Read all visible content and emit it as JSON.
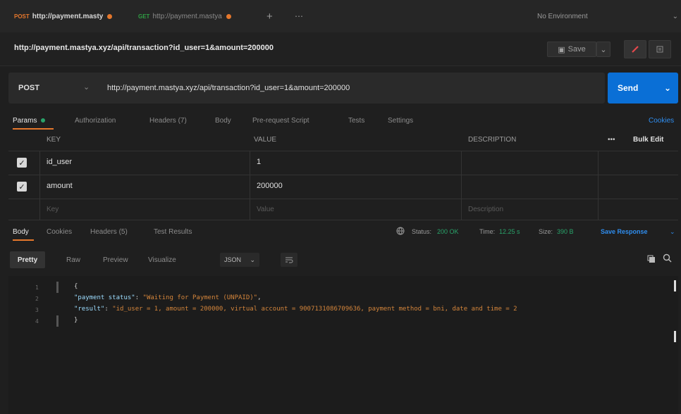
{
  "tabs": [
    {
      "method": "POST",
      "label": "http://payment.masty"
    },
    {
      "method": "GET",
      "label": "http://payment.mastya"
    }
  ],
  "tab_actions": {
    "add": "+",
    "more": "⋯"
  },
  "environment": {
    "label": "No Environment"
  },
  "title": "http://payment.mastya.xyz/api/transaction?id_user=1&amount=200000",
  "save": {
    "label": "Save"
  },
  "request": {
    "method": "POST",
    "url": "http://payment.mastya.xyz/api/transaction?id_user=1&amount=200000",
    "send_label": "Send"
  },
  "request_tabs": {
    "params": "Params",
    "authorization": "Authorization",
    "headers": "Headers (7)",
    "body": "Body",
    "pre_request": "Pre-request Script",
    "tests": "Tests",
    "settings": "Settings",
    "cookies": "Cookies"
  },
  "params_table": {
    "headers": {
      "key": "KEY",
      "value": "VALUE",
      "description": "DESCRIPTION",
      "more": "•••",
      "bulk_edit": "Bulk Edit"
    },
    "rows": [
      {
        "key": "id_user",
        "value": "1",
        "checked": true
      },
      {
        "key": "amount",
        "value": "200000",
        "checked": true
      }
    ],
    "placeholder": {
      "key": "Key",
      "value": "Value",
      "description": "Description"
    }
  },
  "response_tabs": {
    "body": "Body",
    "cookies": "Cookies",
    "headers": "Headers (5)",
    "test_results": "Test Results"
  },
  "status": {
    "status_label": "Status:",
    "status_value": "200 OK",
    "time_label": "Time:",
    "time_value": "12.25 s",
    "size_label": "Size:",
    "size_value": "390 B",
    "save_response": "Save Response"
  },
  "response_toolbar": {
    "pretty": "Pretty",
    "raw": "Raw",
    "preview": "Preview",
    "visualize": "Visualize",
    "format": "JSON"
  },
  "code": {
    "line_numbers": [
      "1",
      "2",
      "3",
      "4"
    ],
    "line1": "{",
    "line2_key": "\"payment status\"",
    "line2_val": "\"Waiting for Payment (UNPAID)\"",
    "line3_key": "\"result\"",
    "line3_val": "\"id_user = 1, amount = 200000, virtual account = 9007131086709636, payment method = bni, date and time = 2",
    "line4": "}"
  },
  "colors": {
    "accent_orange": "#e5772c",
    "send_blue": "#0a6fd6",
    "status_green": "#29a36a"
  }
}
